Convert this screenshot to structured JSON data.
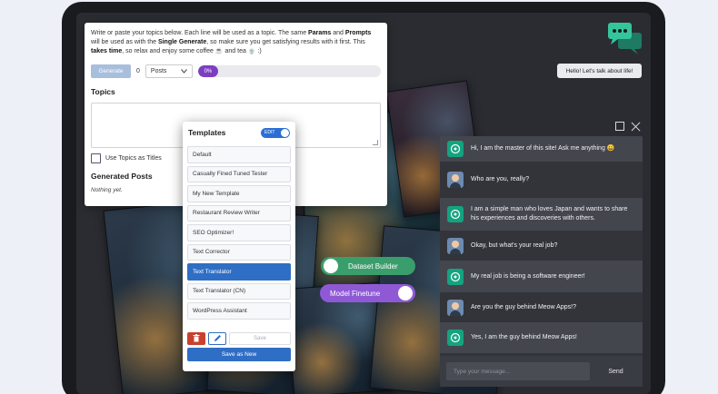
{
  "generator": {
    "intro_parts": [
      "Write or paste your topics below. Each line will be used as a topic. The same ",
      "Params",
      " and ",
      "Prompts",
      " will be used as with the ",
      "Single Generate",
      ", so make sure you get satisfying results with it first. This ",
      "takes time",
      ", so relax and enjoy some coffee ☕ and tea 🍵 :)"
    ],
    "generate_label": "Generate",
    "count": "0",
    "posts_select": "Posts",
    "progress_label": "0%",
    "progress_value": 0,
    "topics_label": "Topics",
    "topics_value": "",
    "use_topics_label": "Use Topics as Titles",
    "generated_posts_label": "Generated Posts",
    "empty_note": "Nothing yet."
  },
  "templates": {
    "title": "Templates",
    "edit_toggle": "EDIT",
    "items": [
      {
        "label": "Default",
        "active": false
      },
      {
        "label": "Casually Fined Tuned Tester",
        "active": false
      },
      {
        "label": "My New Template",
        "active": false
      },
      {
        "label": "Restaurant Review Writer",
        "active": false
      },
      {
        "label": "SEO Optimizer!",
        "active": false
      },
      {
        "label": "Text Corrector",
        "active": false
      },
      {
        "label": "Text Translator",
        "active": true
      },
      {
        "label": "Text Translator (CN)",
        "active": false
      },
      {
        "label": "WordPress Assistant",
        "active": false
      }
    ],
    "save_label": "Save",
    "save_as_new_label": "Save as New"
  },
  "toggles": {
    "dataset_builder": "Dataset Builder",
    "model_finetune": "Model Finetune"
  },
  "chat": {
    "greeting": "Hello! Let's talk about life!",
    "messages": [
      {
        "role": "ai",
        "text": "Hi, I am the master of this site! Ask me anything 😀"
      },
      {
        "role": "user",
        "text": "Who are you, really?"
      },
      {
        "role": "ai",
        "text": "I am a simple man who loves Japan and wants to share his experiences and discoveries with others."
      },
      {
        "role": "user",
        "text": "Okay, but what's your real job?"
      },
      {
        "role": "ai",
        "text": "My real job is being a software engineer!"
      },
      {
        "role": "user",
        "text": "Are you the guy behind Meow Apps!?"
      },
      {
        "role": "ai",
        "text": "Yes, I am the guy behind Meow Apps!"
      }
    ],
    "input_placeholder": "Type your message...",
    "send_label": "Send"
  },
  "colors": {
    "accent_blue": "#2f6ec5",
    "purple": "#8f59d6",
    "green": "#3a9e6c",
    "bot_green": "#14a37f",
    "delete_red": "#c8412e"
  }
}
